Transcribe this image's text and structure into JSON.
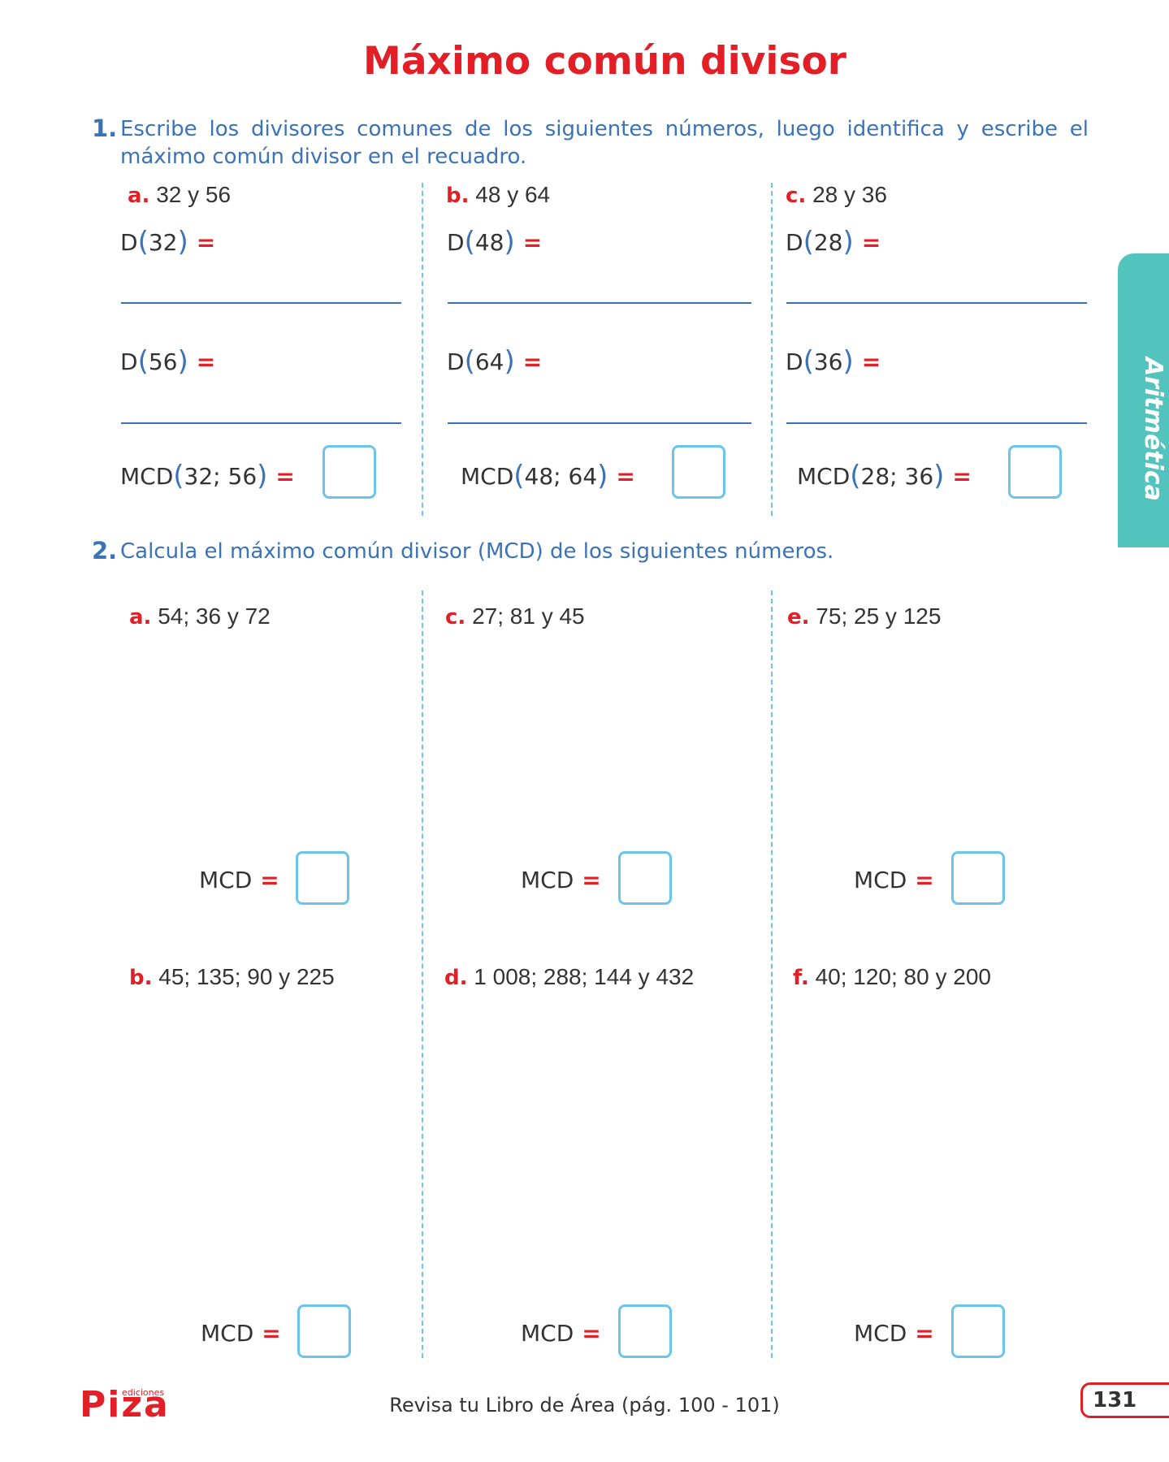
{
  "title": "Máximo común divisor",
  "q1": {
    "number": "1.",
    "instruction": "Escribe los divisores comunes de los siguientes números, luego identifica y escribe el máximo común divisor en el recuadro.",
    "items": [
      {
        "letter": "a.",
        "numbers": "32 y 56",
        "d1_label": "D",
        "d1_arg": "32",
        "d2_label": "D",
        "d2_arg": "56",
        "mcd_label": "MCD",
        "mcd_arg": "32; 56"
      },
      {
        "letter": "b.",
        "numbers": "48 y 64",
        "d1_label": "D",
        "d1_arg": "48",
        "d2_label": "D",
        "d2_arg": "64",
        "mcd_label": "MCD",
        "mcd_arg": "48; 64"
      },
      {
        "letter": "c.",
        "numbers": "28 y 36",
        "d1_label": "D",
        "d1_arg": "28",
        "d2_label": "D",
        "d2_arg": "36",
        "mcd_label": "MCD",
        "mcd_arg": "28; 36"
      }
    ],
    "equals": "="
  },
  "q2": {
    "number": "2.",
    "instruction": "Calcula el máximo común divisor (MCD) de los siguientes números.",
    "items": [
      {
        "letter": "a.",
        "numbers": "54; 36 y 72"
      },
      {
        "letter": "c.",
        "numbers": "27; 81 y 45"
      },
      {
        "letter": "e.",
        "numbers": "75; 25 y 125"
      },
      {
        "letter": "b.",
        "numbers": "45; 135; 90 y 225"
      },
      {
        "letter": "d.",
        "numbers": "1 008; 288; 144 y 432"
      },
      {
        "letter": "f.",
        "numbers": "40; 120; 80 y 200"
      }
    ],
    "mcd_label": "MCD",
    "equals": "="
  },
  "side_tab": "Aritmética",
  "footer": {
    "logo": "Piza",
    "logo_small": "ediciones",
    "note": "Revisa tu Libro de Área (pág. 100 - 101)",
    "page_number": "131"
  },
  "colors": {
    "red": "#e21f26",
    "blue": "#3b73b9",
    "cyan": "#6cc4ea",
    "teal": "#53c3bd"
  }
}
